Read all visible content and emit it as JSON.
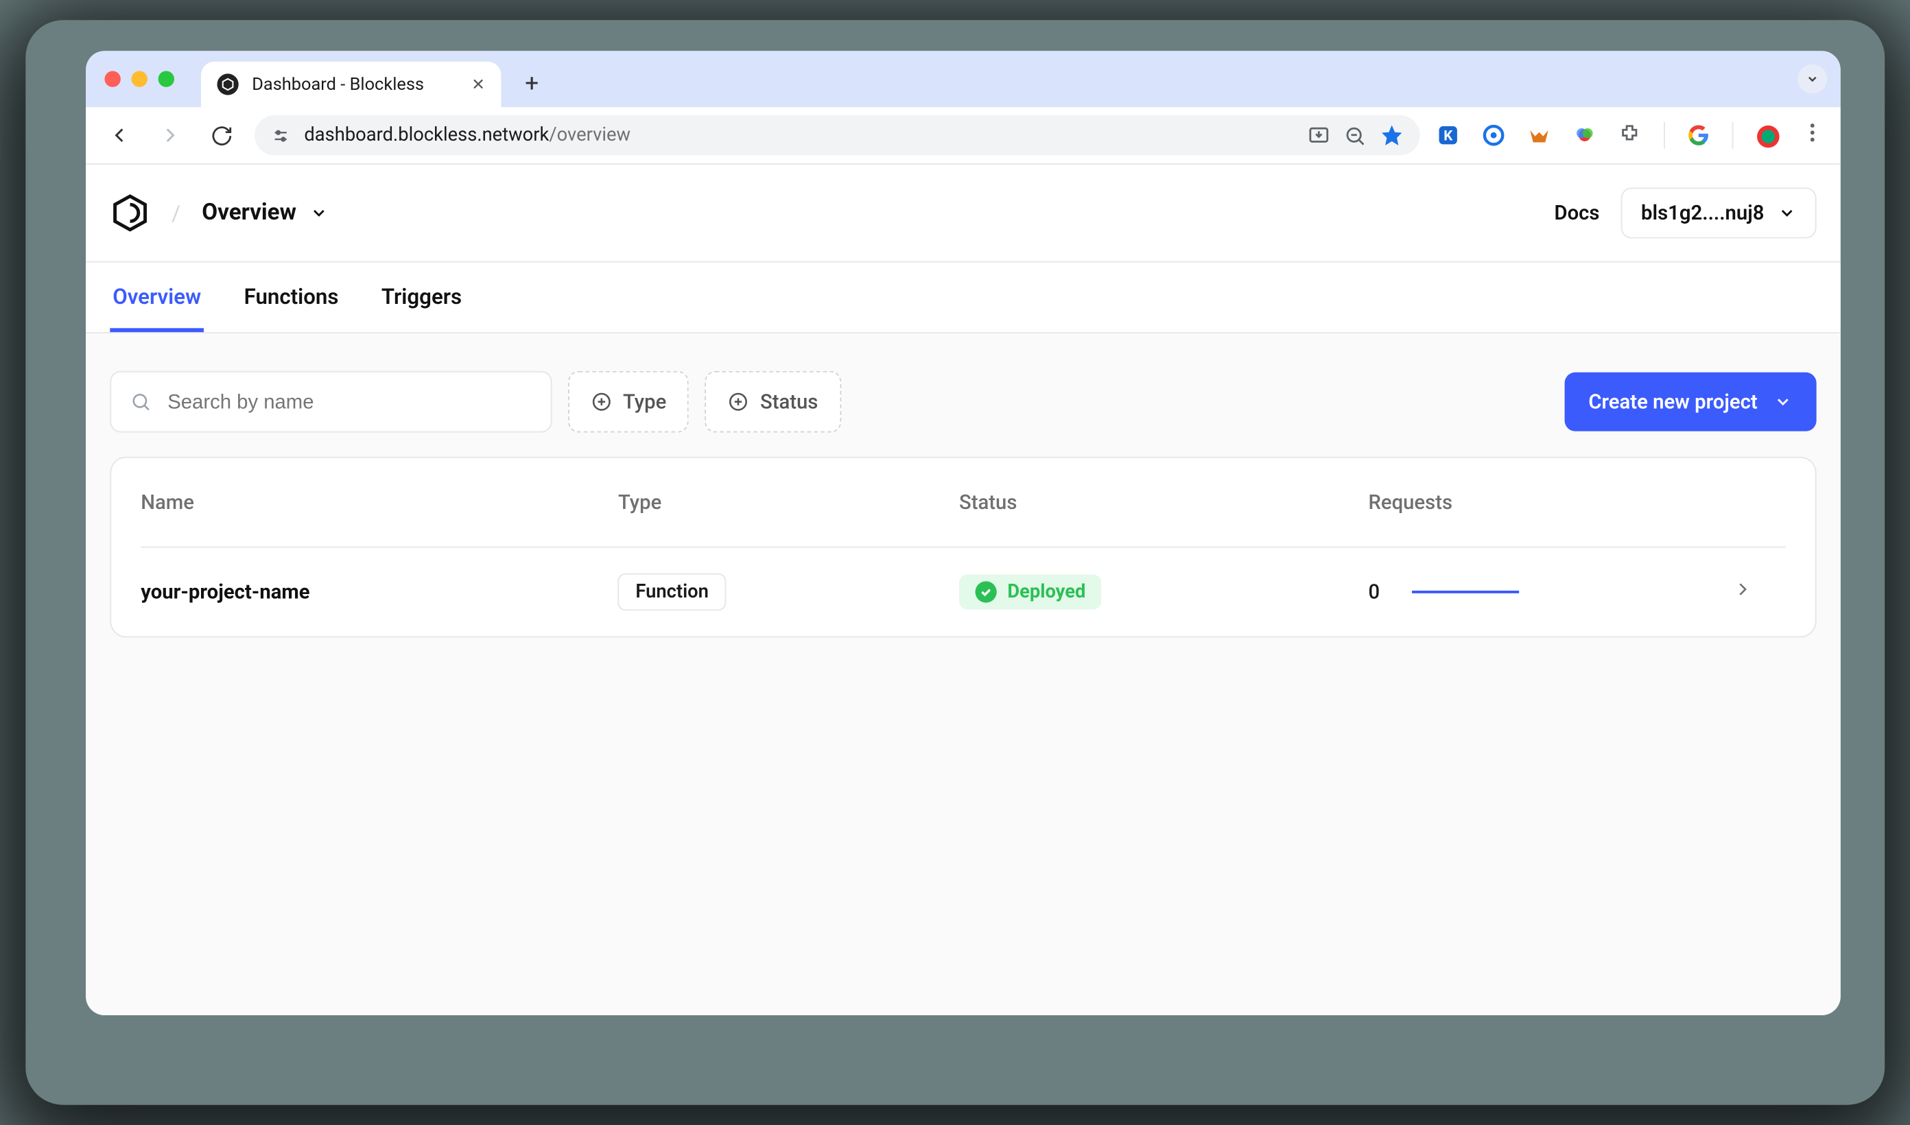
{
  "browser": {
    "tab_title": "Dashboard - Blockless",
    "url_display": "dashboard.blockless.network",
    "url_path": "/overview"
  },
  "header": {
    "breadcrumb": "Overview",
    "docs_label": "Docs",
    "account_label": "bls1g2....nuj8"
  },
  "tabs": [
    {
      "id": "overview",
      "label": "Overview",
      "active": true
    },
    {
      "id": "functions",
      "label": "Functions",
      "active": false
    },
    {
      "id": "triggers",
      "label": "Triggers",
      "active": false
    }
  ],
  "controls": {
    "search_placeholder": "Search by name",
    "filter_type_label": "Type",
    "filter_status_label": "Status",
    "cta_label": "Create new project"
  },
  "table": {
    "columns": {
      "name": "Name",
      "type": "Type",
      "status": "Status",
      "requests": "Requests"
    },
    "rows": [
      {
        "name": "your-project-name",
        "type": "Function",
        "status": "Deployed",
        "requests": "0"
      }
    ]
  },
  "colors": {
    "accent": "#3b5bfd",
    "status_ok": "#2bc055"
  }
}
